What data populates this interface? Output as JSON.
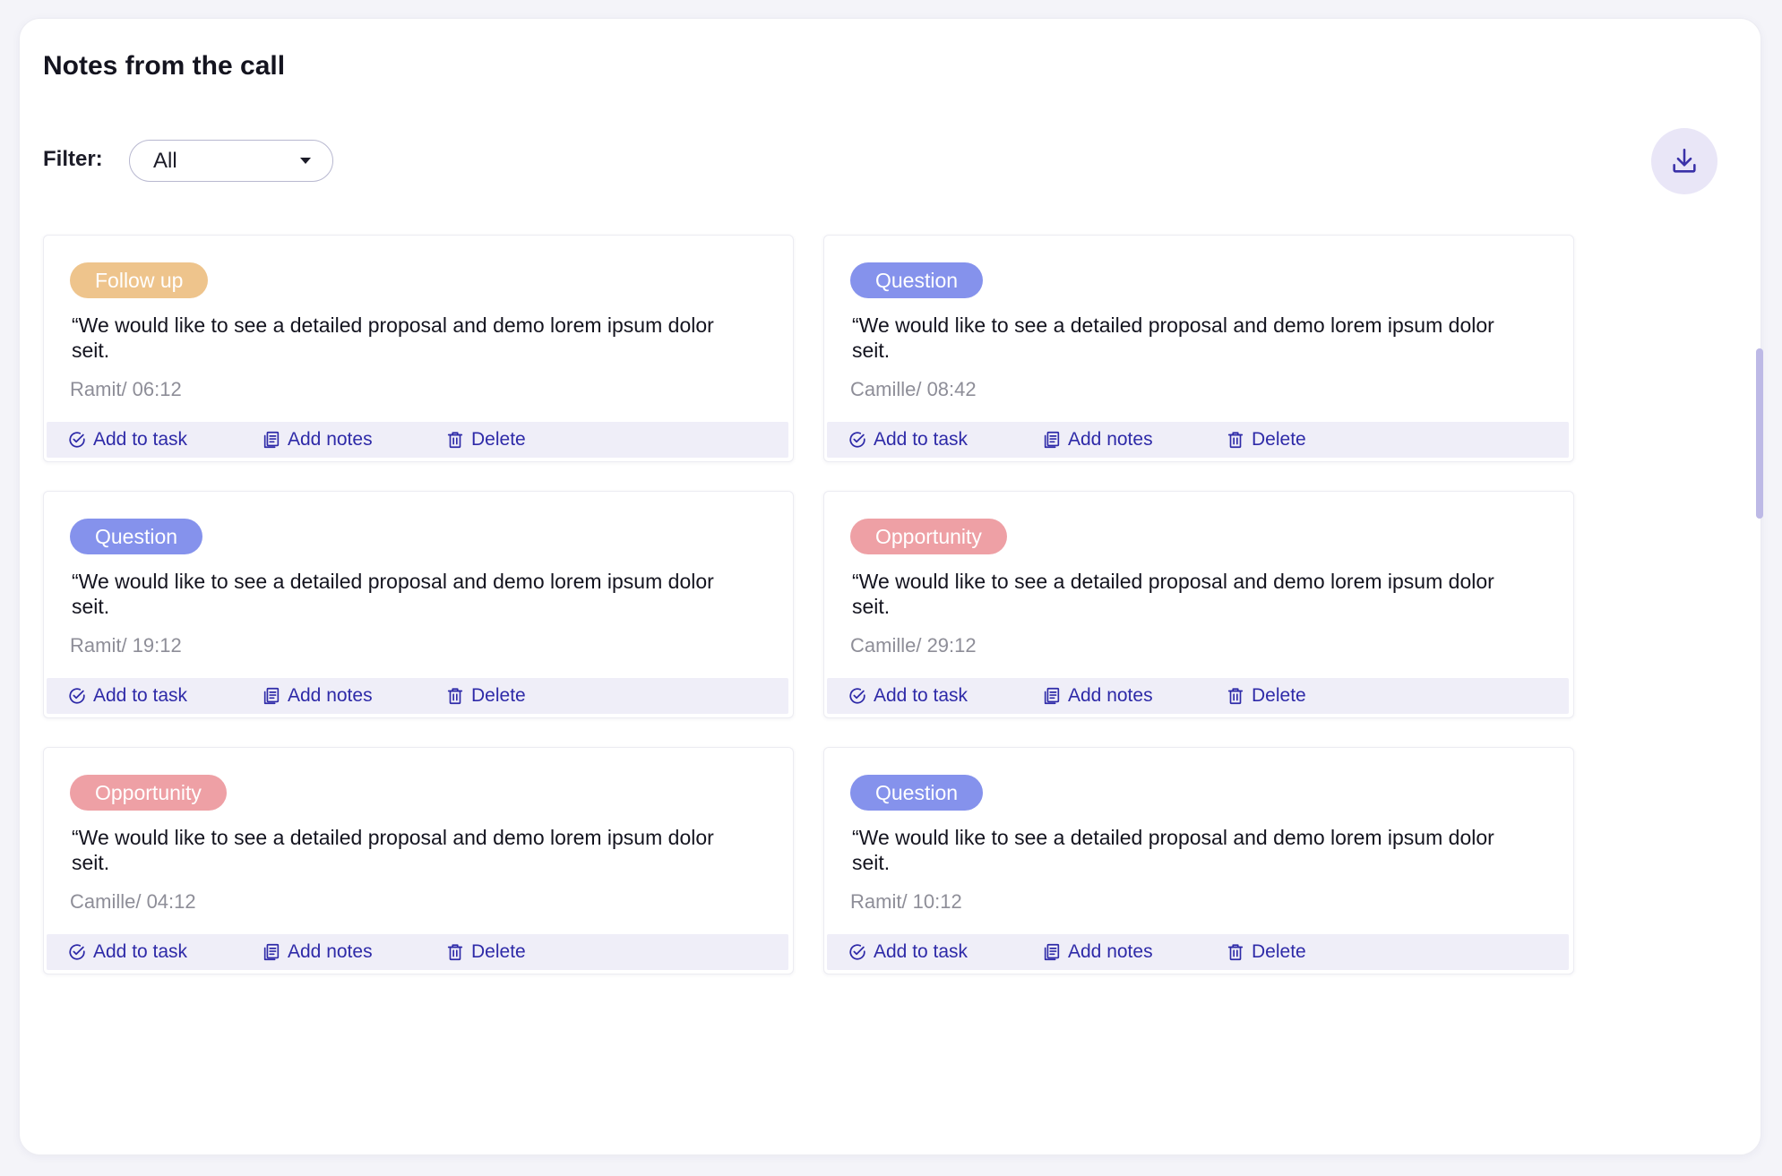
{
  "header": {
    "title": "Notes from the call"
  },
  "filter": {
    "label": "Filter:",
    "value": "All"
  },
  "actions": {
    "add_task": "Add to task",
    "add_notes": "Add notes",
    "delete": "Delete"
  },
  "colors": {
    "follow_up": "#eec48c",
    "question": "#8592ec",
    "opportunity": "#eea0a5",
    "accent": "#2e2aa8"
  },
  "notes": [
    {
      "tag": "Follow up",
      "tag_type": "follow_up",
      "text": "“We would like to see a detailed proposal and demo lorem ipsum dolor seit.",
      "meta": "Ramit/ 06:12"
    },
    {
      "tag": "Question",
      "tag_type": "question",
      "text": "“We would like to see a detailed proposal and demo lorem ipsum dolor seit.",
      "meta": "Camille/ 08:42"
    },
    {
      "tag": "Question",
      "tag_type": "question",
      "text": "“We would like to see a detailed proposal and demo lorem ipsum dolor seit.",
      "meta": "Ramit/ 19:12"
    },
    {
      "tag": "Opportunity",
      "tag_type": "opportunity",
      "text": "“We would like to see a detailed proposal and demo lorem ipsum dolor seit.",
      "meta": "Camille/ 29:12"
    },
    {
      "tag": "Opportunity",
      "tag_type": "opportunity",
      "text": "“We would like to see a detailed proposal and demo lorem ipsum dolor seit.",
      "meta": "Camille/ 04:12"
    },
    {
      "tag": "Question",
      "tag_type": "question",
      "text": "“We would like to see a detailed proposal and demo lorem ipsum dolor seit.",
      "meta": "Ramit/ 10:12"
    }
  ]
}
